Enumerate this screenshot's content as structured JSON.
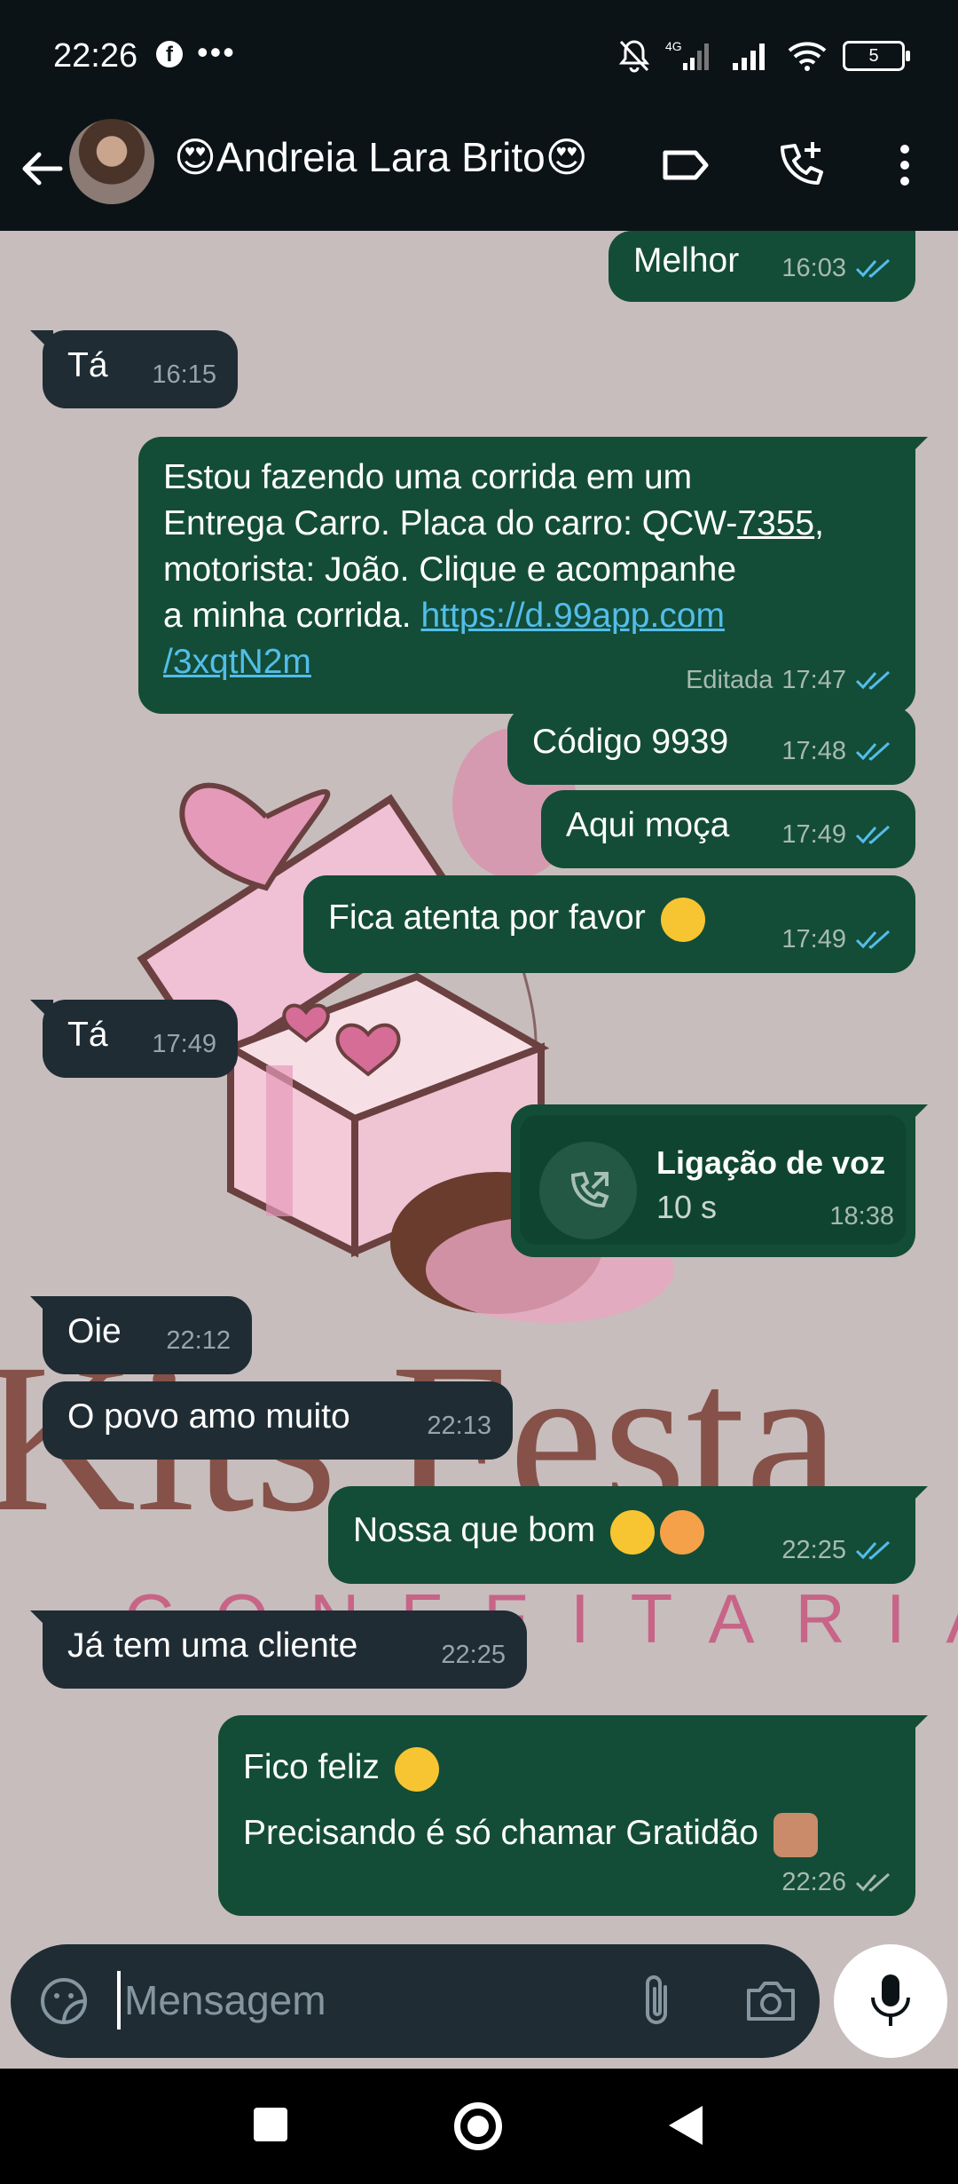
{
  "status_bar": {
    "time": "22:26",
    "battery": "5"
  },
  "header": {
    "contact_name": "😍Andreia Lara Brito😍"
  },
  "messages": [
    {
      "dir": "out",
      "text": "Melhor",
      "time": "16:03"
    },
    {
      "dir": "in",
      "text": "Tá",
      "time": "16:15"
    },
    {
      "dir": "out",
      "lines": [
        "Estou fazendo uma corrida em um",
        "Entrega Carro. Placa do carro: QCW-",
        "7355",
        ",",
        "motorista: João. Clique e acompanhe",
        "a minha corrida. ",
        "https://d.99app.com",
        "/3xqtN2m"
      ],
      "edited": "Editada",
      "time": "17:47"
    },
    {
      "dir": "out",
      "text": "Código 9939",
      "time": "17:48"
    },
    {
      "dir": "out",
      "text": "Aqui moça",
      "time": "17:49"
    },
    {
      "dir": "out",
      "text": "Fica atenta por favor",
      "time": "17:49"
    },
    {
      "dir": "in",
      "text": "Tá",
      "time": "17:49"
    },
    {
      "dir": "out",
      "call_title": "Ligação de voz",
      "call_duration": "10 s",
      "time": "18:38"
    },
    {
      "dir": "in",
      "text": "Oie",
      "time": "22:12"
    },
    {
      "dir": "in",
      "text": "O povo amo muito",
      "time": "22:13"
    },
    {
      "dir": "out",
      "text": "Nossa que bom",
      "time": "22:25"
    },
    {
      "dir": "in",
      "text": "Já tem uma cliente",
      "time": "22:25"
    },
    {
      "dir": "out",
      "lines": [
        "Fico feliz",
        "Precisando é só chamar Gratidão"
      ],
      "time": "22:26"
    }
  ],
  "wallpaper": {
    "line1": "Kits Festa",
    "line2": "CONFEITARIA"
  },
  "composer": {
    "placeholder": "Mensagem"
  },
  "colors": {
    "outgoing": "#134d37",
    "incoming": "#1f2c34",
    "header": "#0c1317",
    "read_ticks": "#53bdeb"
  }
}
